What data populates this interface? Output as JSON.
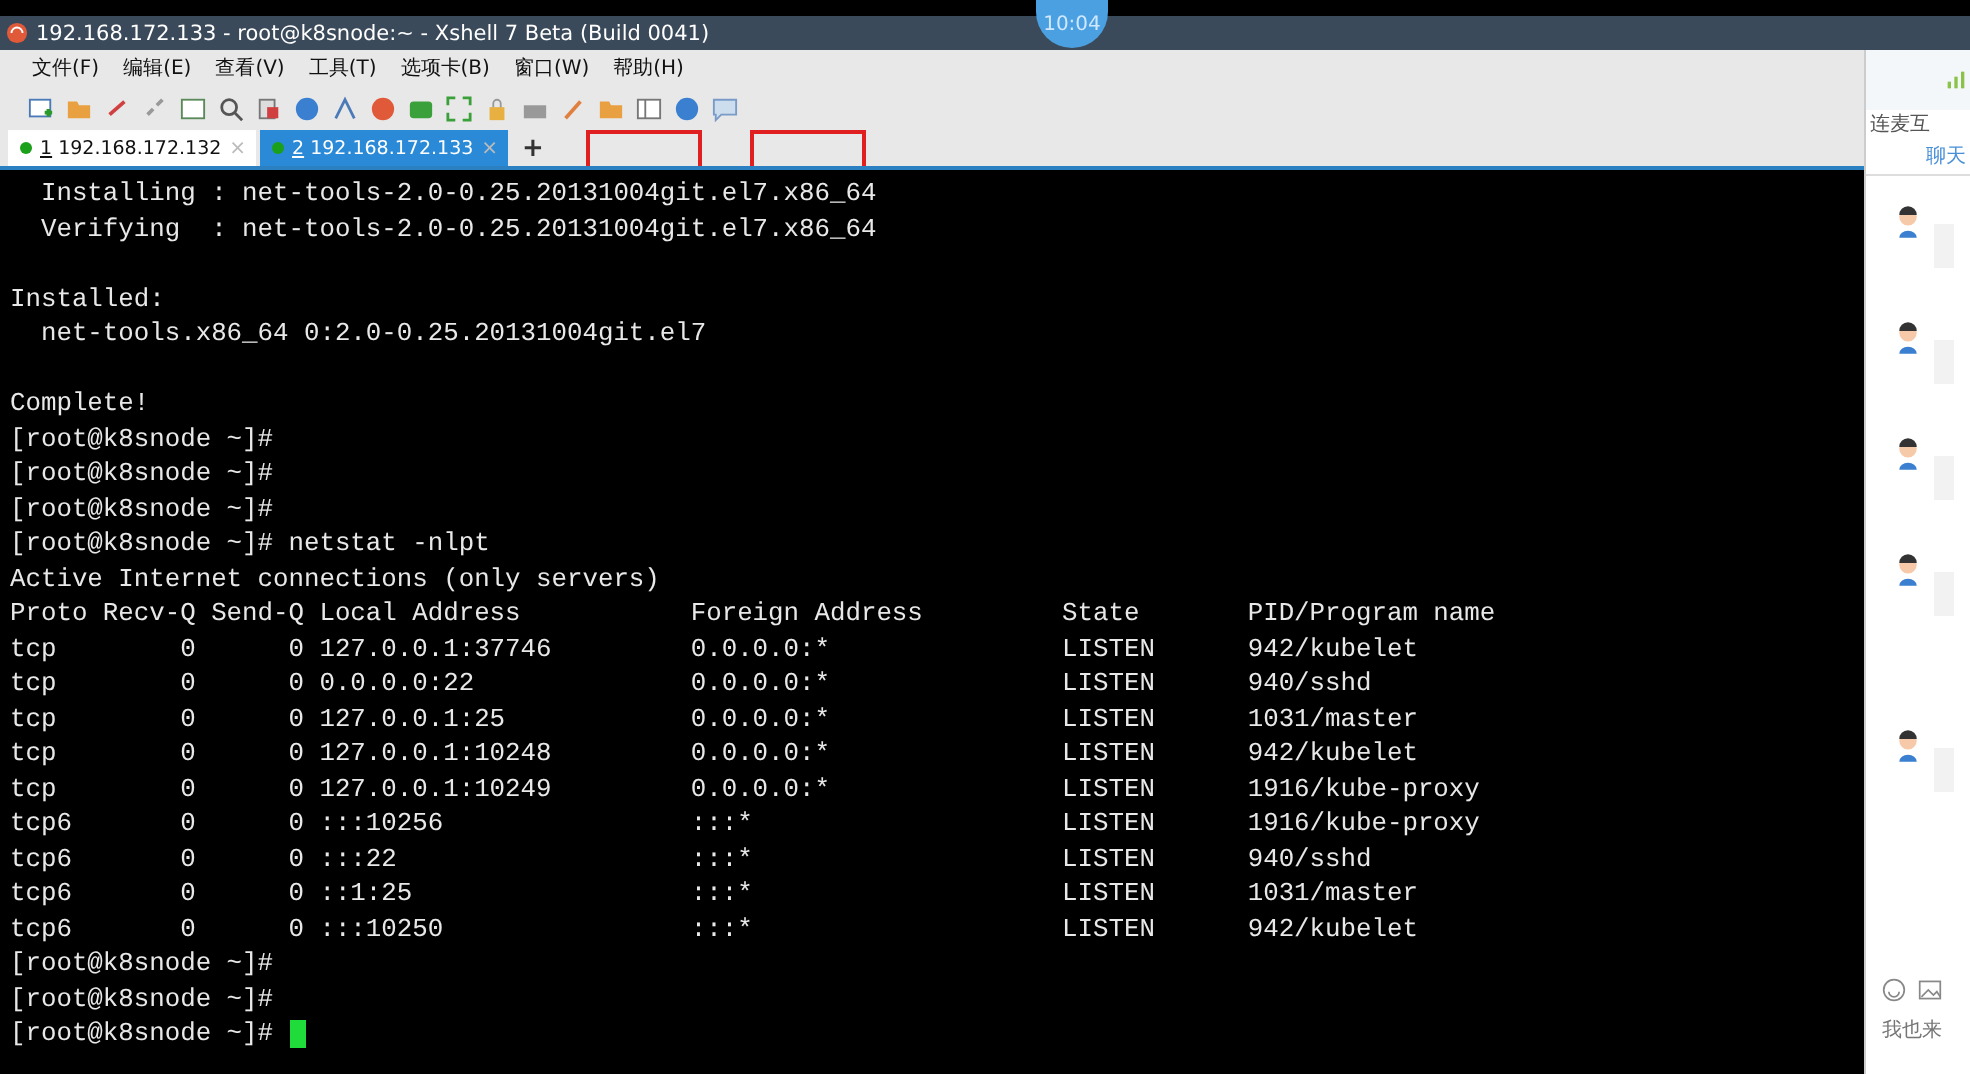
{
  "window": {
    "title": "192.168.172.133 - root@k8snode:~ - Xshell 7 Beta (Build 0041)",
    "clock": "10:04"
  },
  "menu": [
    "文件(F)",
    "编辑(E)",
    "查看(V)",
    "工具(T)",
    "选项卡(B)",
    "窗口(W)",
    "帮助(H)"
  ],
  "tabs": [
    {
      "number": "1",
      "label": "192.168.172.132",
      "close": "×",
      "selected": false
    },
    {
      "number": "2",
      "label": "192.168.172.133",
      "close": "×",
      "selected": true
    }
  ],
  "new_tab": "+",
  "terminal": {
    "blocks": [
      [
        "  Installing : net-tools-2.0-0.25.20131004git.el7.x86_64",
        "  Verifying  : net-tools-2.0-0.25.20131004git.el7.x86_64"
      ],
      [
        "Installed:",
        "  net-tools.x86_64 0:2.0-0.25.20131004git.el7"
      ],
      [
        "Complete!",
        "[root@k8snode ~]#",
        "[root@k8snode ~]#",
        "[root@k8snode ~]#",
        "[root@k8snode ~]# netstat -nlpt",
        "Active Internet connections (only servers)",
        "Proto Recv-Q Send-Q Local Address           Foreign Address         State       PID/Program name",
        "tcp        0      0 127.0.0.1:37746         0.0.0.0:*               LISTEN      942/kubelet",
        "tcp        0      0 0.0.0.0:22              0.0.0.0:*               LISTEN      940/sshd",
        "tcp        0      0 127.0.0.1:25            0.0.0.0:*               LISTEN      1031/master",
        "tcp        0      0 127.0.0.1:10248         0.0.0.0:*               LISTEN      942/kubelet",
        "tcp        0      0 127.0.0.1:10249         0.0.0.0:*               LISTEN      1916/kube-proxy",
        "tcp6       0      0 :::10256                :::*                    LISTEN      1916/kube-proxy",
        "tcp6       0      0 :::22                   :::*                    LISTEN      940/sshd",
        "tcp6       0      0 ::1:25                  :::*                    LISTEN      1031/master",
        "tcp6       0      0 :::10250                :::*                    LISTEN      942/kubelet",
        "[root@k8snode ~]#",
        "[root@k8snode ~]#"
      ]
    ],
    "prompt": "[root@k8snode ~]#"
  },
  "chat_panel": {
    "header": "连麦互",
    "tab": "聊天",
    "input_placeholder": "我也来"
  }
}
